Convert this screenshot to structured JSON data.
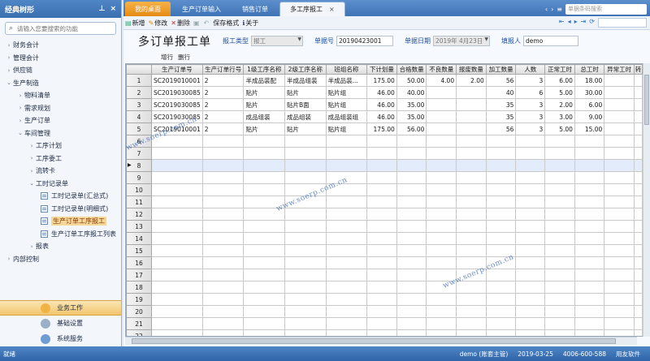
{
  "sidebar": {
    "title": "经典树形",
    "search_placeholder": "请输入您要搜索的功能",
    "items": [
      {
        "label": "财务会计",
        "arrow": "›"
      },
      {
        "label": "管理会计",
        "arrow": "›"
      },
      {
        "label": "供应链",
        "arrow": "›"
      },
      {
        "label": "生产制造",
        "arrow": "⌄"
      },
      {
        "label": "物料清单",
        "arrow": "›"
      },
      {
        "label": "需求规划",
        "arrow": "›"
      },
      {
        "label": "生产订单",
        "arrow": "›"
      },
      {
        "label": "车间管理",
        "arrow": "⌄"
      },
      {
        "label": "工序计划",
        "arrow": "›"
      },
      {
        "label": "工序委工",
        "arrow": "›"
      },
      {
        "label": "流转卡",
        "arrow": "›"
      },
      {
        "label": "工时记录单",
        "arrow": "⌄"
      },
      {
        "label": "工时记录单(汇总式)",
        "arrow": ""
      },
      {
        "label": "工时记录单(明细式)",
        "arrow": ""
      },
      {
        "label": "生产订单工序报工",
        "arrow": ""
      },
      {
        "label": "生产订单工序报工列表",
        "arrow": ""
      },
      {
        "label": "报表",
        "arrow": "›"
      },
      {
        "label": "内部控制",
        "arrow": "›"
      }
    ],
    "bottom": [
      {
        "label": "业务工作"
      },
      {
        "label": "基础设置"
      },
      {
        "label": "系统服务"
      }
    ]
  },
  "tabs": [
    {
      "label": "我的桌面"
    },
    {
      "label": "生产订单输入"
    },
    {
      "label": "销售订单"
    },
    {
      "label": "多工序报工",
      "close": "×"
    }
  ],
  "tab_search_placeholder": "单据条码搜索",
  "toolbar": {
    "new": "新增",
    "edit": "修改",
    "delete": "删除",
    "save_format": "保存格式",
    "about": "关于"
  },
  "form": {
    "title": "多订单报工单",
    "type_label": "报工类型",
    "type_value": "报工",
    "no_label": "单据号",
    "no_value": "20190423001",
    "date_label": "单据日期",
    "date_value": "2019年 4月23日",
    "reporter_label": "填报人",
    "reporter_value": "demo",
    "add_row": "增行",
    "del_row": "删行"
  },
  "grid": {
    "columns": [
      "生产订单号",
      "生产订单行号",
      "1级工序名称",
      "2级工序名称",
      "班组名称",
      "下计划量",
      "合格数量",
      "不良数量",
      "报废数量",
      "加工数量",
      "人数",
      "正常工时",
      "总工时",
      "异常工时",
      "转"
    ],
    "rows": [
      [
        "SC2019010001",
        "2",
        "半成品装配",
        "半成品组装",
        "半成品装...",
        "175.00",
        "50.00",
        "4.00",
        "2.00",
        "56",
        "3",
        "6.00",
        "18.00",
        "",
        ""
      ],
      [
        "SC2019030085",
        "2",
        "贴片",
        "贴片",
        "贴片组",
        "46.00",
        "40.00",
        "",
        "",
        "40",
        "6",
        "5.00",
        "30.00",
        "",
        ""
      ],
      [
        "SC2019030085",
        "2",
        "贴片",
        "贴片B面",
        "贴片组",
        "46.00",
        "35.00",
        "",
        "",
        "35",
        "3",
        "2.00",
        "6.00",
        "",
        ""
      ],
      [
        "SC2019030085",
        "2",
        "成品组装",
        "成品组装",
        "成品组装组",
        "46.00",
        "35.00",
        "",
        "",
        "35",
        "3",
        "3.00",
        "9.00",
        "",
        ""
      ],
      [
        "SC2019010001",
        "2",
        "贴片",
        "贴片",
        "贴片组",
        "175.00",
        "56.00",
        "",
        "",
        "56",
        "3",
        "5.00",
        "15.00",
        "",
        ""
      ]
    ],
    "row_numbers": [
      "1",
      "2",
      "3",
      "4",
      "5",
      "6",
      "7",
      "8",
      "9",
      "10",
      "11",
      "12",
      "13",
      "14",
      "15",
      "16",
      "17",
      "18",
      "19",
      "20",
      "21",
      "22"
    ],
    "current_row_marker": "▶"
  },
  "watermark": "www.soerp.com.cn",
  "status": {
    "left": "就绪",
    "user": "demo (账套主管)",
    "date": "2019-03-25",
    "phone": "4006-600-588",
    "brand": "用友软件"
  },
  "colors": {
    "accent": "#3e73b5",
    "home_tab": "#e68b12",
    "selected_item": "#f5d79c"
  }
}
